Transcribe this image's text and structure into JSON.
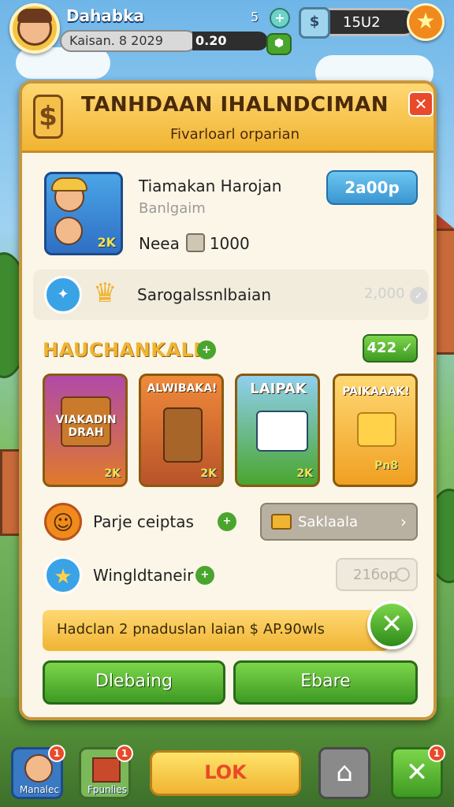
{
  "top_bar": {
    "player_name": "Dahabka",
    "level_text": "Kaisan. 8 2029",
    "xp_text": "0.20",
    "xp_count": "5",
    "currency_value": "15U2"
  },
  "panel": {
    "title": "TANHDAAN IHALNDCIMAN",
    "subtitle": "Fivarloarl orparian",
    "item": {
      "name": "Tiamakan Harojan",
      "sub": "Banlgaim",
      "need_label": "Neea",
      "need_value": "1000",
      "price": "2a00p",
      "card_badge": "2K"
    },
    "bonus": {
      "label": "Sarogalssnlbaian",
      "value": "2,000"
    },
    "section": {
      "title": "HAUCHANKALK",
      "count": "422"
    },
    "cards": [
      {
        "label": "VIAKADIN DRAH",
        "badge": "2K"
      },
      {
        "label": "ALWIBAKA!",
        "badge": "2K"
      },
      {
        "label": "LAIPAK",
        "badge": "2K"
      },
      {
        "label": "PAIKAAAK!",
        "badge": "Pn8"
      }
    ],
    "rows": [
      {
        "label": "Parje ceiptas",
        "button": "Saklaala"
      },
      {
        "label": "Wingldtaneir",
        "button": "21бор"
      }
    ],
    "promo_text": "Hadclan 2 pnaduslan  laian $ AP.90wls",
    "buttons": {
      "left": "Dlebaing",
      "right": "Ebare"
    }
  },
  "bottom_nav": {
    "profile_label": "Manalec",
    "profile_badge": "1",
    "shop_label": "Fpunlies",
    "shop_badge": "1",
    "ok_label": "LOK",
    "close_badge": "1"
  }
}
